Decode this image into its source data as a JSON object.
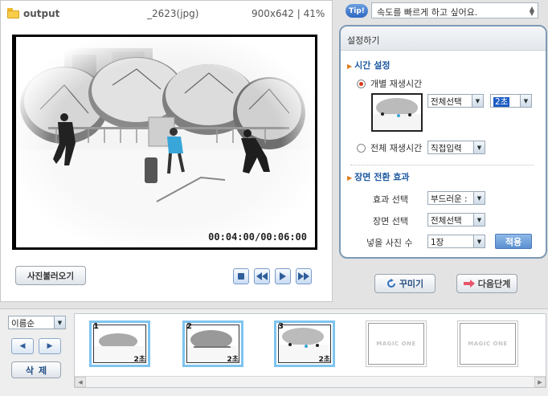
{
  "header": {
    "folder_name": "output",
    "file_name": "_2623(jpg)",
    "file_meta": "900x642 | 41%"
  },
  "preview": {
    "time_display": "00:04:00/00:06:00",
    "load_photo_label": "사진불러오기",
    "controls": [
      "stop-icon",
      "rewind-icon",
      "play-icon",
      "fast-forward-icon"
    ]
  },
  "tip": {
    "badge": "Tip!",
    "text": "속도를 빠르게 하고 싶어요."
  },
  "settings": {
    "title": "설정하기",
    "time_section": {
      "title": "시간 설정",
      "individual_label": "개별 재생시간",
      "individual_selected": true,
      "select_scope": "전체선택",
      "duration": "2초",
      "total_label": "전체 재생시간",
      "total_input": "직접입력"
    },
    "transition_section": {
      "title": "장면 전환 효과",
      "effect_label": "효과 선택",
      "effect_value": "부드러운 :",
      "scene_label": "장면 선택",
      "scene_value": "전체선택",
      "count_label": "넣을 사진 수",
      "count_value": "1장",
      "apply_label": "적용"
    }
  },
  "actions": {
    "decorate_label": "꾸미기",
    "next_label": "다음단계"
  },
  "filmstrip": {
    "sort_value": "이름순",
    "delete_label": "삭제",
    "thumbs": [
      {
        "num": "1",
        "duration": "2초"
      },
      {
        "num": "2",
        "duration": "2초"
      },
      {
        "num": "3",
        "duration": "2초"
      }
    ],
    "placeholder_text": "MAGIC ONE"
  },
  "colors": {
    "accent": "#1f5aa0",
    "panel_border": "#7d9ab5",
    "thumb_highlight": "#7ec4f0",
    "radio_on": "#d9361b"
  }
}
